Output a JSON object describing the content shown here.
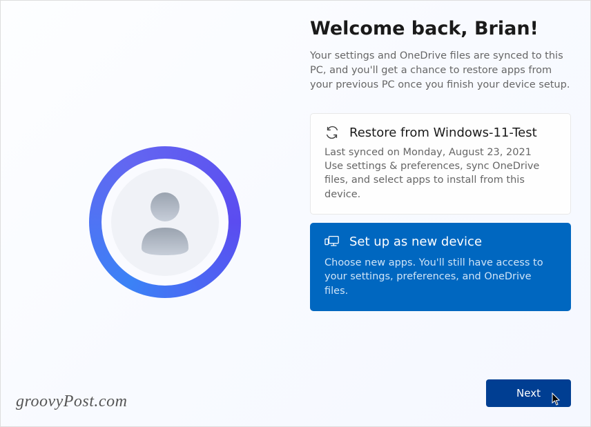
{
  "heading": "Welcome back, Brian!",
  "subtext": "Your settings and OneDrive files are synced to this PC, and you'll get a chance to restore apps from your previous PC once you finish your device setup.",
  "options": {
    "restore": {
      "title": "Restore from Windows-11-Test",
      "lastsync": "Last synced on Monday, August 23, 2021",
      "desc": "Use settings & preferences, sync OneDrive files, and select apps to install from this device."
    },
    "newdevice": {
      "title": "Set up as new device",
      "desc": "Choose new apps. You'll still have access to your settings, preferences, and OneDrive files."
    }
  },
  "next_label": "Next",
  "watermark": "groovyPost.com"
}
